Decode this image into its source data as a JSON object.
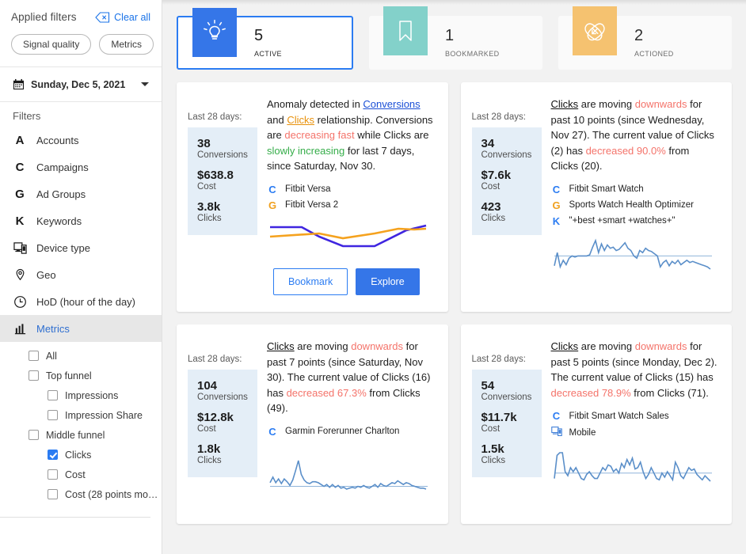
{
  "sidebar": {
    "applied_filters_title": "Applied filters",
    "clear_all_label": "Clear all",
    "clear_icon": "clear-all-icon",
    "chips": [
      {
        "label": "Signal quality"
      },
      {
        "label": "Metrics"
      }
    ],
    "date_picker": {
      "icon": "calendar-icon",
      "value": "Sunday, Dec 5, 2021",
      "caret": "chevron-down-icon"
    },
    "filters_title": "Filters",
    "filters": [
      {
        "label": "Accounts",
        "icon": "letter-a-icon",
        "active": false
      },
      {
        "label": "Campaigns",
        "icon": "letter-c-icon",
        "active": false
      },
      {
        "label": "Ad Groups",
        "icon": "letter-g-icon",
        "active": false
      },
      {
        "label": "Keywords",
        "icon": "letter-k-icon",
        "active": false
      },
      {
        "label": "Device type",
        "icon": "device-icon",
        "active": false
      },
      {
        "label": "Geo",
        "icon": "location-pin-icon",
        "active": false
      },
      {
        "label": "HoD (hour of the day)",
        "icon": "clock-icon",
        "active": false
      },
      {
        "label": "Metrics",
        "icon": "bar-chart-icon",
        "active": true
      }
    ],
    "metric_checks": [
      {
        "label": "All",
        "checked": false,
        "level": 0
      },
      {
        "label": "Top funnel",
        "checked": false,
        "level": 0
      },
      {
        "label": "Impressions",
        "checked": false,
        "level": 1
      },
      {
        "label": "Impression Share",
        "checked": false,
        "level": 1
      },
      {
        "label": "Middle funnel",
        "checked": false,
        "level": 0
      },
      {
        "label": "Clicks",
        "checked": true,
        "level": 1
      },
      {
        "label": "Cost",
        "checked": false,
        "level": 1
      },
      {
        "label": "Cost (28 points movi…",
        "checked": false,
        "level": 1
      }
    ]
  },
  "summary": [
    {
      "count": "5",
      "label": "Active",
      "icon": "lightbulb-icon",
      "color": "#3576e8",
      "selected": true
    },
    {
      "count": "1",
      "label": "Bookmarked",
      "icon": "bookmark-icon",
      "color": "#83d1ca",
      "selected": false
    },
    {
      "count": "2",
      "label": "Actioned",
      "icon": "actioned-icon",
      "color": "#f5c270",
      "selected": false
    }
  ],
  "cards": [
    {
      "last_days_label": "Last 28 days:",
      "metrics": [
        {
          "value": "38",
          "name": "Conversions"
        },
        {
          "value": "$638.8",
          "name": "Cost"
        },
        {
          "value": "3.8k",
          "name": "Clicks"
        }
      ],
      "text_parts": [
        {
          "t": "Anomaly detected in ",
          "s": "plain"
        },
        {
          "t": "Conversions",
          "s": "link-blue"
        },
        {
          "t": " and ",
          "s": "plain"
        },
        {
          "t": "Clicks",
          "s": "link-orange"
        },
        {
          "t": " relationship. Conversions are ",
          "s": "plain"
        },
        {
          "t": "decreasing fast",
          "s": "neg"
        },
        {
          "t": " while Clicks are ",
          "s": "plain"
        },
        {
          "t": "slowly increasing",
          "s": "pos"
        },
        {
          "t": " for last 7 days, since Saturday, Nov 30.",
          "s": "plain"
        }
      ],
      "entities": [
        {
          "icon": "c",
          "label": "Fitbit Versa"
        },
        {
          "icon": "g",
          "label": "Fitbit Versa 2"
        }
      ],
      "chart": "dual-line",
      "buttons": [
        {
          "label": "Bookmark",
          "style": "secondary"
        },
        {
          "label": "Explore",
          "style": "primary"
        }
      ]
    },
    {
      "last_days_label": "Last 28 days:",
      "metrics": [
        {
          "value": "34",
          "name": "Conversions"
        },
        {
          "value": "$7.6k",
          "name": "Cost"
        },
        {
          "value": "423",
          "name": "Clicks"
        }
      ],
      "text_parts": [
        {
          "t": "Clicks",
          "s": "link-black"
        },
        {
          "t": " are moving ",
          "s": "plain"
        },
        {
          "t": "downwards",
          "s": "neg"
        },
        {
          "t": " for past 10 points (since Wednesday, Nov 27). The current value of Clicks (2) has ",
          "s": "plain"
        },
        {
          "t": "decreased 90.0%",
          "s": "neg"
        },
        {
          "t": " from Clicks (20).",
          "s": "plain"
        }
      ],
      "entities": [
        {
          "icon": "c",
          "label": "Fitbit Smart Watch"
        },
        {
          "icon": "g",
          "label": "Sports Watch Health Optimizer"
        },
        {
          "icon": "k",
          "label": "\"+best +smart +watches+\""
        }
      ],
      "chart": "sparkline-2",
      "buttons": []
    },
    {
      "last_days_label": "Last 28 days:",
      "metrics": [
        {
          "value": "104",
          "name": "Conversions"
        },
        {
          "value": "$12.8k",
          "name": "Cost"
        },
        {
          "value": "1.8k",
          "name": "Clicks"
        }
      ],
      "text_parts": [
        {
          "t": "Clicks",
          "s": "link-black"
        },
        {
          "t": " are moving ",
          "s": "plain"
        },
        {
          "t": "downwards",
          "s": "neg"
        },
        {
          "t": " for past 7 points (since Saturday, Nov 30). The current value of Clicks (16) has ",
          "s": "plain"
        },
        {
          "t": "decreased 67.3%",
          "s": "neg"
        },
        {
          "t": " from Clicks (49).",
          "s": "plain"
        }
      ],
      "entities": [
        {
          "icon": "c",
          "label": "Garmin Forerunner Charlton"
        }
      ],
      "chart": "sparkline-3",
      "buttons": []
    },
    {
      "last_days_label": "Last 28 days:",
      "metrics": [
        {
          "value": "54",
          "name": "Conversions"
        },
        {
          "value": "$11.7k",
          "name": "Cost"
        },
        {
          "value": "1.5k",
          "name": "Clicks"
        }
      ],
      "text_parts": [
        {
          "t": "Clicks",
          "s": "link-black"
        },
        {
          "t": " are moving ",
          "s": "plain"
        },
        {
          "t": "downwards",
          "s": "neg"
        },
        {
          "t": " for past 5 points (since Monday, Dec 2). The current value of Clicks (15) has ",
          "s": "plain"
        },
        {
          "t": "decreased 78.9%",
          "s": "neg"
        },
        {
          "t": " from Clicks (71).",
          "s": "plain"
        }
      ],
      "entities": [
        {
          "icon": "c",
          "label": "Fitbit Smart Watch Sales"
        },
        {
          "icon": "dev",
          "label": "Mobile"
        }
      ],
      "chart": "sparkline-4",
      "buttons": []
    }
  ],
  "chart_data": [
    {
      "type": "line",
      "title": "Conversions vs Clicks relationship",
      "series": [
        {
          "name": "Conversions",
          "color": "#3f25e0",
          "values": [
            62,
            62,
            62,
            40,
            20,
            18,
            18,
            18,
            40,
            62,
            66
          ]
        },
        {
          "name": "Clicks",
          "color": "#f5a21e",
          "values": [
            52,
            56,
            60,
            66,
            60,
            56,
            60,
            66,
            70,
            68,
            64
          ]
        }
      ],
      "grid": false,
      "legend": "none"
    },
    {
      "type": "line",
      "title": "Clicks trend (28 points)",
      "series": [
        {
          "name": "Clicks",
          "color": "#5b8fc9",
          "values": [
            12,
            36,
            10,
            22,
            14,
            26,
            30,
            28,
            30,
            30,
            30,
            30,
            32,
            46,
            58,
            36,
            52,
            40,
            50,
            44,
            46,
            40,
            42,
            48,
            54,
            44,
            40,
            30,
            26,
            40,
            36,
            44,
            40,
            38,
            34,
            30,
            10,
            18,
            22,
            12,
            20,
            16,
            22,
            14,
            18,
            22,
            18,
            20,
            18,
            16,
            14,
            12,
            10,
            6
          ]
        }
      ],
      "baseline": 30,
      "grid": false,
      "legend": "none"
    },
    {
      "type": "line",
      "title": "Clicks trend (28 points)",
      "series": [
        {
          "name": "Clicks",
          "color": "#5b8fc9",
          "values": [
            22,
            34,
            22,
            30,
            20,
            30,
            24,
            16,
            28,
            48,
            70,
            40,
            28,
            22,
            20,
            24,
            24,
            22,
            18,
            14,
            18,
            12,
            18,
            12,
            16,
            10,
            12,
            8,
            10,
            12,
            10,
            14,
            12,
            16,
            12,
            10,
            14,
            18,
            12,
            20,
            16,
            14,
            18,
            22,
            20,
            26,
            22,
            18,
            22,
            20,
            16,
            14,
            12,
            10,
            10,
            8
          ]
        }
      ],
      "baseline": 14,
      "grid": false,
      "legend": "none"
    },
    {
      "type": "line",
      "title": "Clicks trend (28 points)",
      "series": [
        {
          "name": "Clicks",
          "color": "#5b8fc9",
          "values": [
            6,
            40,
            44,
            44,
            16,
            10,
            22,
            16,
            22,
            14,
            6,
            4,
            12,
            16,
            10,
            6,
            6,
            14,
            22,
            18,
            26,
            24,
            16,
            20,
            14,
            28,
            22,
            34,
            26,
            36,
            20,
            22,
            30,
            16,
            6,
            12,
            22,
            14,
            6,
            4,
            14,
            8,
            16,
            10,
            4,
            30,
            22,
            10,
            6,
            14,
            22,
            18,
            20,
            12,
            8,
            4,
            10,
            6,
            2
          ]
        }
      ],
      "baseline": 14,
      "grid": false,
      "legend": "none"
    }
  ]
}
